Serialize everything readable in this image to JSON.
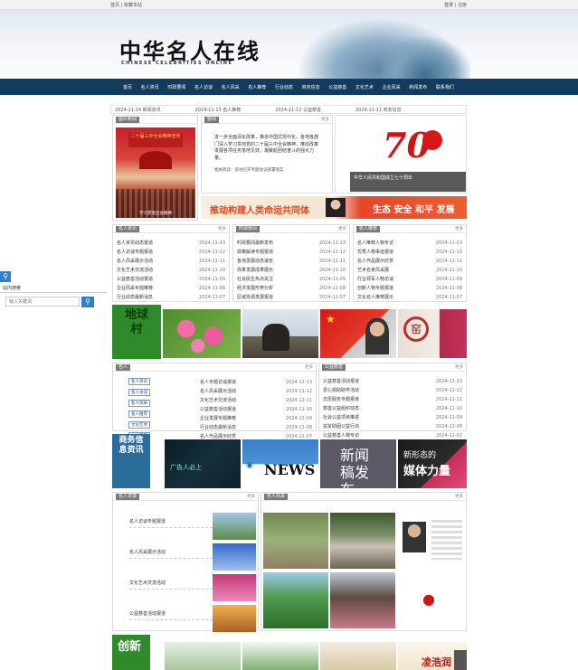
{
  "topbar": {
    "left": "首页 | 收藏本站",
    "right": "登录 | 注册"
  },
  "site": {
    "title": "中华名人在线",
    "subtitle": "CHINESE CELEBRITIES ONLINE"
  },
  "nav": [
    "首页",
    "名人资讯",
    "时政要闻",
    "名人访谈",
    "名人风采",
    "名人推荐",
    "行业动态",
    "商务信息",
    "公益慈善",
    "文化艺术",
    "企业风采",
    "新闻发布",
    "联系我们"
  ],
  "ticker": [
    "2024-11-14 新闻资讯",
    "2024-11-13 名人推荐",
    "2024-11-12 公益慈善",
    "2024-11-11 商务信息"
  ],
  "focus": {
    "tag": "图片新闻",
    "poster": "二十届三中全会精神宣传",
    "caption": "学习贯彻全会精神"
  },
  "headline": {
    "tag": "要闻",
    "more": "更多",
    "text": "进一步全面深化改革，推进中国式现代化。各地各部门深入学习贯彻党的二十届三中全会精神，推动改革发展各项任务落地见效，凝聚起团结奋斗的强大力量。",
    "small": "相关阅读：多地召开专题会议部署落实"
  },
  "seventy": {
    "number": "70",
    "caption": "中华人民共和国成立七十周年"
  },
  "banner_strip": {
    "left": "推动构建人类命运共同体",
    "right": "生态 安全 和平 发展"
  },
  "col1": {
    "tag": "名人资讯",
    "more": "更多",
    "items": [
      {
        "t": "名人资讯动态报道",
        "d": "2024-11-13"
      },
      {
        "t": "名人访谈专题报道",
        "d": "2024-11-12"
      },
      {
        "t": "名人风采展示活动",
        "d": "2024-11-11"
      },
      {
        "t": "文化艺术交流活动",
        "d": "2024-11-10"
      },
      {
        "t": "公益慈善活动报道",
        "d": "2024-11-09"
      },
      {
        "t": "企业风采专题推荐",
        "d": "2024-11-08"
      },
      {
        "t": "行业动态最新消息",
        "d": "2024-11-07"
      }
    ]
  },
  "col2": {
    "tag": "时政要闻",
    "more": "更多",
    "items": [
      {
        "t": "时政要闻最新发布",
        "d": "2024-11-13"
      },
      {
        "t": "政策解读专题报道",
        "d": "2024-11-12"
      },
      {
        "t": "各地发展动态速览",
        "d": "2024-11-11"
      },
      {
        "t": "改革发展成果展示",
        "d": "2024-11-10"
      },
      {
        "t": "社会民生热点关注",
        "d": "2024-11-09"
      },
      {
        "t": "经济发展形势分析",
        "d": "2024-11-08"
      },
      {
        "t": "区域协调发展报道",
        "d": "2024-11-07"
      }
    ]
  },
  "col3": {
    "tag": "名人推荐",
    "more": "更多",
    "items": [
      {
        "t": "名人推荐人物专访",
        "d": "2024-11-13"
      },
      {
        "t": "优秀人物事迹报道",
        "d": "2024-11-12"
      },
      {
        "t": "名人作品展示欣赏",
        "d": "2024-11-11"
      },
      {
        "t": "艺术名家风采展",
        "d": "2024-11-10"
      },
      {
        "t": "行业领军人物访谈",
        "d": "2024-11-09"
      },
      {
        "t": "创新人物专题报道",
        "d": "2024-11-08"
      },
      {
        "t": "文化名人推荐展示",
        "d": "2024-11-07"
      }
    ]
  },
  "sidebar": {
    "title": "站内搜索",
    "placeholder": "输入关键词"
  },
  "photos1": {
    "village": "地球村"
  },
  "mid_left": {
    "tag": "名人",
    "more": "更多",
    "buttons": [
      "名人资讯",
      "名人访谈",
      "名人风采",
      "名人推荐",
      "文化艺术",
      "公益慈善",
      "企业风采"
    ],
    "items": [
      {
        "t": "名人专题访谈报道",
        "d": "2024-11-13"
      },
      {
        "t": "名人风采展示活动",
        "d": "2024-11-12"
      },
      {
        "t": "文化艺术交流活动",
        "d": "2024-11-11"
      },
      {
        "t": "公益慈善活动报道",
        "d": "2024-11-10"
      },
      {
        "t": "企业发展专题推荐",
        "d": "2024-11-09"
      },
      {
        "t": "行业动态最新消息",
        "d": "2024-11-08"
      },
      {
        "t": "名人作品展示欣赏",
        "d": "2024-11-07"
      }
    ]
  },
  "mid_right": {
    "tag": "公益慈善",
    "more": "更多",
    "items": [
      {
        "t": "公益慈善活动报道",
        "d": "2024-11-13"
      },
      {
        "t": "爱心捐助助学活动",
        "d": "2024-11-12"
      },
      {
        "t": "志愿服务专题报道",
        "d": "2024-11-11"
      },
      {
        "t": "慈善公益组织动态",
        "d": "2024-11-10"
      },
      {
        "t": "社会公益项目推进",
        "d": "2024-11-09"
      },
      {
        "t": "扶贫助困公益行动",
        "d": "2024-11-08"
      },
      {
        "t": "公益慈善人物专访",
        "d": "2024-11-07"
      }
    ]
  },
  "photos2": {
    "biz": "商务信息资讯",
    "ad": "广告人必上",
    "news": "NEWS",
    "press": "新闻稿发布",
    "media1": "新形态的",
    "media2": "媒体力量"
  },
  "bottom_left": {
    "tag": "名人访谈",
    "more": "更多",
    "items": [
      "名人访谈专题报道",
      "名人风采展示活动",
      "文化艺术交流活动",
      "公益慈善活动报道"
    ]
  },
  "bottom_right": {
    "tag": "名人风采",
    "more": "更多"
  },
  "last_row": {
    "c1": "创新",
    "c2": "凌浩润"
  }
}
